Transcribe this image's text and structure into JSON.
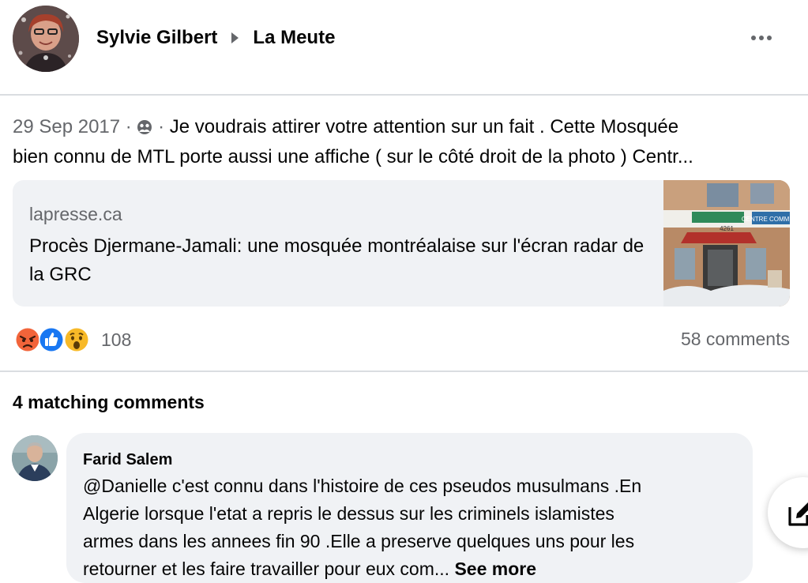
{
  "post": {
    "author": "Sylvie Gilbert",
    "group": "La Meute",
    "date": "29 Sep 2017",
    "separator": " · ",
    "privacy_icon": "group-privacy-icon",
    "text_line1": "Je voudrais attirer votre attention sur un fait . Cette Mosquée",
    "text_line2": "bien connu de MTL porte aussi une affiche ( sur le côté droit de la photo ) Centr..."
  },
  "link": {
    "domain": "lapresse.ca",
    "title": "Procès Djermane-Jamali: une mosquée montréalaise sur l'écran radar de la GRC",
    "thumb_signs": [
      "CENTRE COMMU",
      "4261"
    ]
  },
  "reactions": {
    "icons": [
      "angry-reaction-icon",
      "like-reaction-icon",
      "wow-reaction-icon"
    ],
    "count": "108",
    "comments": "58 comments"
  },
  "comments_section": {
    "title": "4 matching comments",
    "comment": {
      "author": "Farid Salem",
      "line1": "@Danielle c'est connu dans l'histoire de ces pseudos musulmans .En",
      "line2": "Algerie lorsque l'etat a repris le dessus sur les criminels islamistes",
      "line3": "armes dans les annees fin 90 .Elle a preserve quelques uns pour les",
      "line4": "retourner et les faire travailler pour eux com...",
      "see_more": "See more"
    }
  },
  "colors": {
    "secondary_text": "#65676b",
    "card_bg": "#f0f2f5",
    "like_blue": "#1877f2",
    "angry_orange": "#f2643a",
    "wow_yellow": "#f7b928"
  }
}
